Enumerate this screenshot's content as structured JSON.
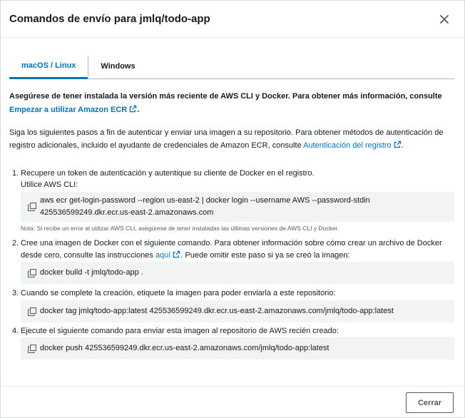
{
  "modal": {
    "title": "Comandos de envío para jmlq/todo-app",
    "close_icon": "close-icon"
  },
  "tabs": [
    {
      "label": "macOS / Linux",
      "active": true
    },
    {
      "label": "Windows",
      "active": false
    }
  ],
  "intro": {
    "text": "Asegúrese de tener instalada la versión más reciente de AWS CLI y Docker. Para obtener más información, consulte ",
    "link": "Empezar a utilizar Amazon ECR",
    "suffix": "."
  },
  "steps_intro": {
    "text": "Siga los siguientes pasos a fin de autenticar y enviar una imagen a su repositorio. Para obtener métodos de autenticación de registro adicionales, incluido el ayudante de credenciales de Amazon ECR, consulte ",
    "link": "Autenticación del registro",
    "suffix": "."
  },
  "steps": [
    {
      "num": "1.",
      "text": "Recupere un token de autenticación y autentique su cliente de Docker en el registro.",
      "subtext": "Utilice AWS CLI:",
      "code_line1": "aws ecr get-login-password --region us-east-2 | docker login --username AWS --password-stdin",
      "code_line2": "425536599249.dkr.ecr.us-east-2.amazonaws.com",
      "note": "Nota: Si recibe un error al utilizar AWS CLI, asegúrese de tener instaladas las últimas versiones de AWS CLI y Docker."
    },
    {
      "num": "2.",
      "text_a": "Cree una imagen de Docker con el siguiente comando. Para obtener información sobre cómo crear un archivo de Docker desde cero, consulte las instrucciones ",
      "link": "aquí",
      "text_b": ". Puede omitir este paso si ya se creó la imagen:",
      "code": "docker build -t jmlq/todo-app ."
    },
    {
      "num": "3.",
      "text": "Cuando se complete la creación, etiquete la imagen para poder enviarla a este repositorio:",
      "code": "docker tag jmlq/todo-app:latest 425536599249.dkr.ecr.us-east-2.amazonaws.com/jmlq/todo-app:latest"
    },
    {
      "num": "4.",
      "text": "Ejecute el siguiente comando para enviar esta imagen al repositorio de AWS recién creado:",
      "code": "docker push 425536599249.dkr.ecr.us-east-2.amazonaws.com/jmlq/todo-app:latest"
    }
  ],
  "footer": {
    "close_label": "Cerrar"
  },
  "colors": {
    "link": "#0073bb",
    "code_bg": "#f2f3f3",
    "text": "#16191f"
  }
}
